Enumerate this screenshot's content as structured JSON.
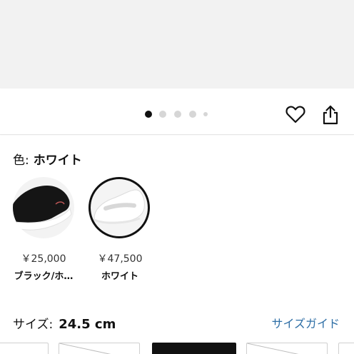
{
  "carousel": {
    "page_count": 5,
    "active_index": 0
  },
  "actions": {
    "favorite_icon": "heart-icon",
    "share_icon": "share-icon"
  },
  "color": {
    "label": "色:",
    "selected": "ホワイト",
    "options": [
      {
        "price": "￥25,000",
        "name": "ブラック/ホ…"
      },
      {
        "price": "￥47,500",
        "name": "ホワイト"
      }
    ]
  },
  "size": {
    "label": "サイズ:",
    "selected": "24.5 cm",
    "guide_label": "サイズガイド"
  },
  "colors": {
    "link": "#2f6fa6",
    "active_dot": "#111111"
  }
}
